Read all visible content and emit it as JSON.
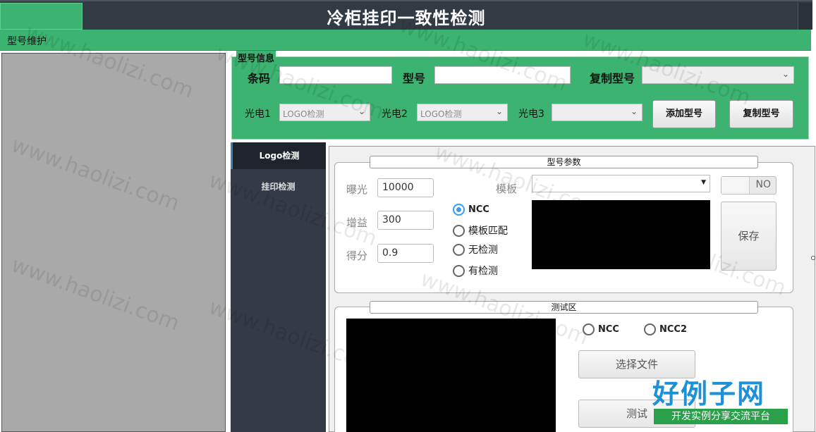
{
  "window": {
    "title": "冷柜挂印一致性检测"
  },
  "menu": {
    "items": [
      "型号维护"
    ]
  },
  "model_info": {
    "legend": "型号信息",
    "barcode_label": "条码",
    "barcode_value": "",
    "model_label": "型号",
    "model_value": "",
    "copy_model_label": "复制型号",
    "copy_model_value": "",
    "sensor1_label": "光电1",
    "sensor1_value": "LOGO检测",
    "sensor2_label": "光电2",
    "sensor2_value": "LOGO检测",
    "sensor3_label": "光电3",
    "sensor3_value": "",
    "add_button": "添加型号",
    "copy_button": "复制型号"
  },
  "tabs": [
    {
      "label": "Logo检测",
      "active": true
    },
    {
      "label": "挂印检测",
      "active": false
    }
  ],
  "params": {
    "title": "型号参数",
    "exposure_label": "曝光",
    "exposure_value": "10000",
    "gain_label": "增益",
    "gain_value": "300",
    "score_label": "得分",
    "score_value": "0.9",
    "radios": [
      {
        "label": "NCC",
        "checked": true
      },
      {
        "label": "模板匹配",
        "checked": false
      },
      {
        "label": "无检测",
        "checked": false
      },
      {
        "label": "有检测",
        "checked": false
      }
    ],
    "template_label": "模板",
    "template_value": "",
    "toggle_label": "NO",
    "save_button": "保存"
  },
  "test_area": {
    "title": "测试区",
    "radios": [
      {
        "label": "NCC",
        "checked": false
      },
      {
        "label": "NCC2",
        "checked": false
      }
    ],
    "select_file_button": "选择文件",
    "test_button": "测试"
  },
  "watermark": {
    "text": "www.haolizi.com"
  },
  "logo": {
    "main": "好例子网",
    "sub": "开发实例分享交流平台"
  },
  "colors": {
    "accent_green": "#3cb371",
    "titlebar": "#323b44",
    "nav_dark": "#343a46",
    "radio_blue": "#3b9cf3"
  }
}
